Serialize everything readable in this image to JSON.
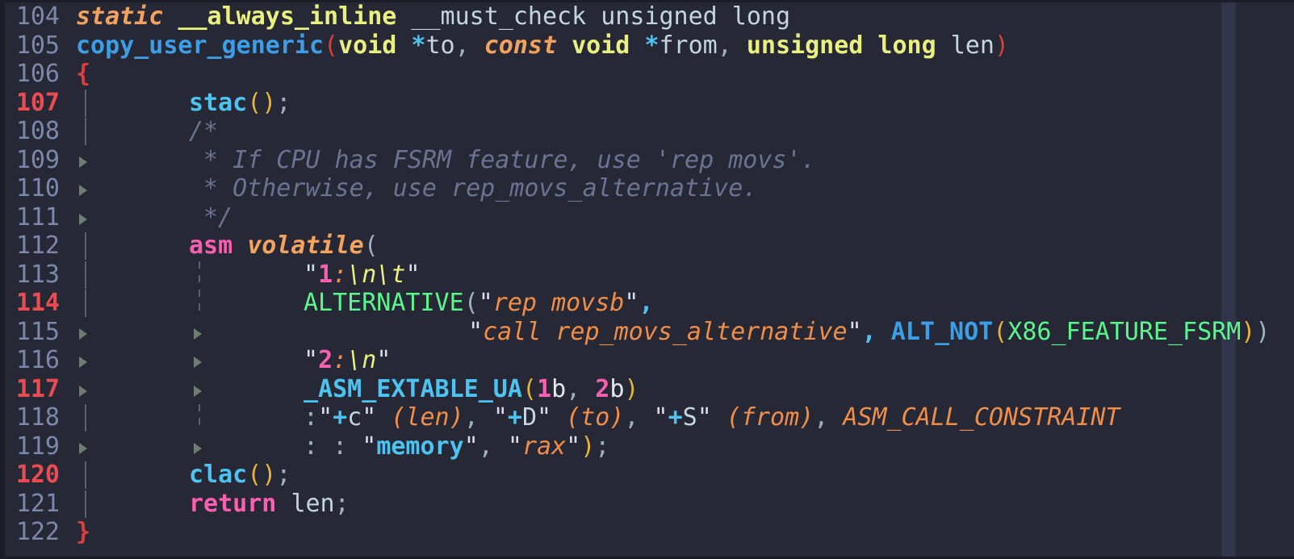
{
  "app": {
    "type": "code-editor",
    "language": "C",
    "theme_background": "#262935",
    "first_line": 104,
    "last_line": 122
  },
  "colors": {
    "background": "#262935",
    "gutter_text": "#7c88ab",
    "gutter_highlight": "#ec4b52",
    "comment": "#6b7392",
    "string": "#f08d49",
    "keyword": "#e9f07e",
    "keyword2": "#ff5fb0",
    "storage": "#f5a25e",
    "function": "#3d9ee8",
    "function_call": "#4cc3f0",
    "macro": "#5af78e",
    "number": "#ff5fb0",
    "brace": "#d93f3f",
    "indent_guide": "#586274",
    "whitespace_marker": "#6d7d72",
    "column_guide": "#31354a"
  },
  "lines": [
    {
      "number": "104",
      "highlight": false,
      "text": "static __always_inline __must_check unsigned long"
    },
    {
      "number": "105",
      "highlight": false,
      "text": "copy_user_generic(void *to, const void *from, unsigned long len)"
    },
    {
      "number": "106",
      "highlight": false,
      "text": "{"
    },
    {
      "number": "107",
      "highlight": true,
      "text": "        stac();"
    },
    {
      "number": "108",
      "highlight": false,
      "text": "        /*"
    },
    {
      "number": "109",
      "highlight": false,
      "text": "         * If CPU has FSRM feature, use 'rep movs'."
    },
    {
      "number": "110",
      "highlight": false,
      "text": "         * Otherwise, use rep_movs_alternative."
    },
    {
      "number": "111",
      "highlight": false,
      "text": "         */"
    },
    {
      "number": "112",
      "highlight": false,
      "text": "        asm volatile("
    },
    {
      "number": "113",
      "highlight": false,
      "text": "                \"1:\\n\\t\""
    },
    {
      "number": "114",
      "highlight": true,
      "text": "                ALTERNATIVE(\"rep movsb\","
    },
    {
      "number": "115",
      "highlight": false,
      "text": "                            \"call rep_movs_alternative\", ALT_NOT(X86_FEATURE_FSRM))"
    },
    {
      "number": "116",
      "highlight": false,
      "text": "                \"2:\\n\""
    },
    {
      "number": "117",
      "highlight": true,
      "text": "                _ASM_EXTABLE_UA(1b, 2b)"
    },
    {
      "number": "118",
      "highlight": false,
      "text": "                :\"+c\" (len), \"+D\" (to), \"+S\" (from), ASM_CALL_CONSTRAINT"
    },
    {
      "number": "119",
      "highlight": false,
      "text": "                : : \"memory\", \"rax\");"
    },
    {
      "number": "120",
      "highlight": true,
      "text": "        clac();"
    },
    {
      "number": "121",
      "highlight": false,
      "text": "        return len;"
    },
    {
      "number": "122",
      "highlight": false,
      "text": "}"
    }
  ]
}
